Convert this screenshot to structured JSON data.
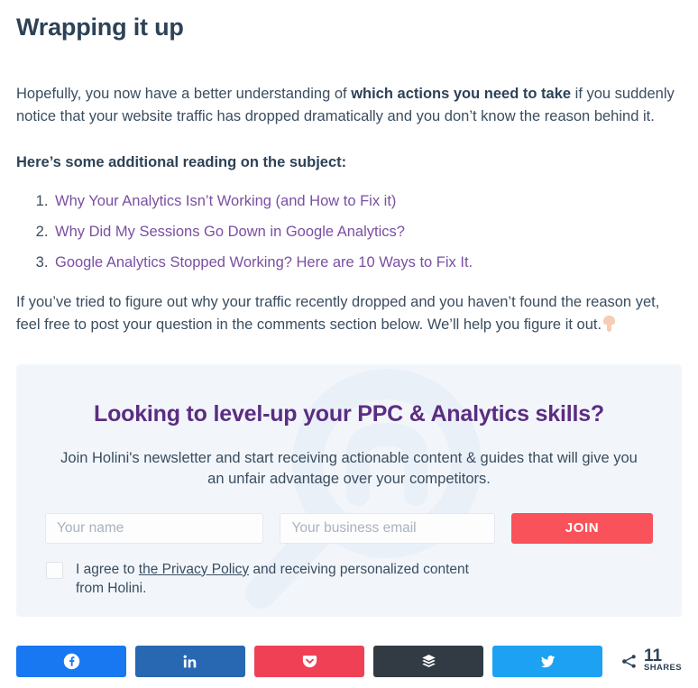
{
  "article": {
    "title": "Wrapping it up",
    "paragraph_1_pre": "Hopefully, you now have a better understanding of ",
    "paragraph_1_bold": "which actions you need to take",
    "paragraph_1_post": " if you suddenly notice that your website traffic has dropped dramatically and you don’t know the reason behind it.",
    "lead_in": "Here’s some additional reading on the subject:",
    "reading_list": [
      "Why Your Analytics Isn’t Working (and How to Fix it)",
      "Why Did My Sessions Go Down in Google Analytics?",
      "Google Analytics Stopped Working? Here are 10 Ways to Fix It."
    ],
    "paragraph_2": "If you’ve tried to figure out why your traffic recently dropped and you haven’t found the reason yet, feel free to post your question in the comments section below. We’ll help you figure it out.",
    "paragraph_2_emoji": "point-down-hand-emoji",
    "link_color": "#7a4fa3",
    "heading_color": "#2d4257"
  },
  "cta": {
    "title": "Looking to level-up your PPC & Analytics skills?",
    "subtitle": "Join Holini's newsletter and start receiving actionable content & guides that will give you an unfair advantage over your competitors.",
    "name_placeholder": "Your name",
    "name_value": "",
    "email_placeholder": "Your business email",
    "email_value": "",
    "join_label": "JOIN",
    "consent_pre": "I agree to ",
    "consent_link": "the Privacy Policy",
    "consent_post": " and receiving personalized content from Holini.",
    "consent_checked": false,
    "background_color": "#f2f6fb",
    "title_color": "#5b2d82",
    "button_color": "#f9525b",
    "watermark": "holini-magnifier-logo-watermark"
  },
  "share_bar": {
    "buttons": [
      {
        "name": "facebook",
        "icon": "facebook-icon",
        "color": "#1778f2",
        "label": ""
      },
      {
        "name": "linkedin",
        "icon": "linkedin-icon",
        "color": "#2867b2",
        "label": ""
      },
      {
        "name": "pocket",
        "icon": "pocket-icon",
        "color": "#ef4056",
        "label": ""
      },
      {
        "name": "buffer",
        "icon": "buffer-icon",
        "color": "#323b43",
        "label": ""
      },
      {
        "name": "twitter",
        "icon": "twitter-icon",
        "color": "#1da1f2",
        "label": ""
      }
    ],
    "count": "11",
    "count_label": "SHARES",
    "share_icon": "share-network-icon"
  }
}
